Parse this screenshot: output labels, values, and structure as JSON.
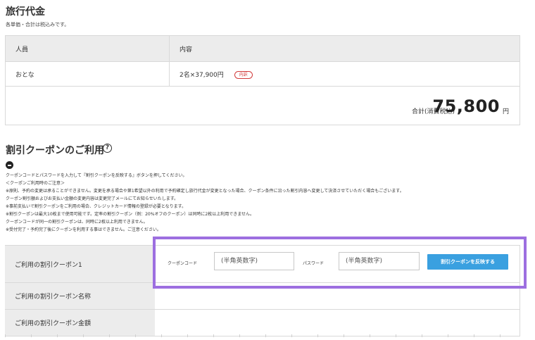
{
  "fare": {
    "title": "旅行代金",
    "note": "各単価・合計は税込みです。",
    "col_people": "人員",
    "col_content": "内容",
    "row_type": "おとな",
    "row_detail": "2名×37,900円",
    "breakdown_badge": "内訳",
    "total_label": "合計(消費税込)",
    "total_value": "75,800",
    "total_unit": "円"
  },
  "coupon": {
    "title": "割引クーポンのご利用",
    "notes": [
      "クーポンコードとパスワードを入力して『割引クーポンを反映する』ボタンを押してください。",
      "＜クーポンご利用時のご注意＞",
      "※原則、予約の変更は承ることができません。変更を承る場合や第1希望以外の利用で予約確定し旅行代金が変更となった場合、クーポン条件に沿った割引内容へ変更して決済させていただく場合もございます。",
      "クーポン割引額およびお支払い金額の変更内容は変更完了メールにてお知らせいたします。",
      "※事前支払いで割引クーポンをご利用の場合、クレジットカード情報の登録が必要となります。",
      "※割引クーポンは最大10枚まで使用可能です。定率の割引クーポン（例：20%オフのクーポン）は同時に2枚以上利用できません。",
      "クーポンコードが同一の割引クーポンは、同時に2枚以上利用できません。",
      "※受付完了・予約完了後にクーポンを利用する事はできません。ご注意ください。"
    ],
    "row1_label": "ご利用の割引クーポン1",
    "code_label": "クーポンコード",
    "code_placeholder": "(半角英数字)",
    "password_label": "パスワード",
    "password_placeholder": "(半角英数字)",
    "apply_button": "割引クーポンを反映する",
    "row2_label": "ご利用の割引クーポン名称",
    "row3_label": "ご利用の割引クーポン金額"
  },
  "colors": {
    "highlight": "#9d6fe0",
    "apply_button": "#3aa0e0",
    "badge": "#d23a3a",
    "table_header_bg": "#ececec"
  },
  "icons": {
    "help": "question-circle-icon",
    "collapse": "minus-circle-icon"
  }
}
